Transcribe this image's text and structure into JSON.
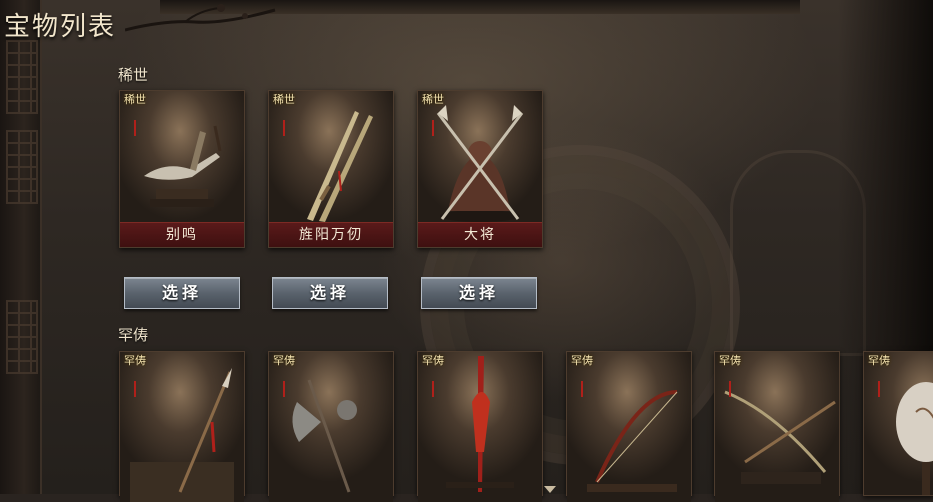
{
  "page_title": "宝物列表",
  "sections": {
    "rare": {
      "label": "稀世",
      "badge": "稀世",
      "items": [
        {
          "name": "别鸣",
          "button": "选择",
          "icon": "curved-blade-icon"
        },
        {
          "name": "旌阳万仞",
          "button": "选择",
          "icon": "crossed-swords-icon"
        },
        {
          "name": "大将",
          "button": "选择",
          "icon": "crossed-halberds-icon"
        }
      ]
    },
    "scarce": {
      "label": "罕俦",
      "badge": "罕俦",
      "items": [
        {
          "icon": "spear-icon"
        },
        {
          "icon": "axe-icon"
        },
        {
          "icon": "red-glaive-icon"
        },
        {
          "icon": "bow-icon"
        },
        {
          "icon": "crossbow-icon"
        },
        {
          "icon": "folding-screen-icon"
        }
      ]
    }
  },
  "colors": {
    "name_bar": "#4a1414",
    "button": "#5a636d",
    "badge_text": "#f6e4b0"
  }
}
